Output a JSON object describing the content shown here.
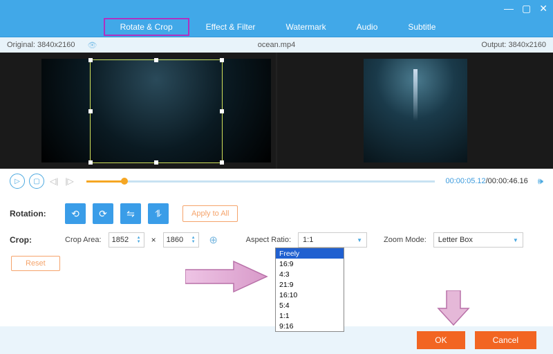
{
  "window": {
    "minimize_glyph": "—",
    "maximize_glyph": "▢",
    "close_glyph": "✕"
  },
  "tabs": {
    "rotate_crop": "Rotate & Crop",
    "effect_filter": "Effect & Filter",
    "watermark": "Watermark",
    "audio": "Audio",
    "subtitle": "Subtitle"
  },
  "infobar": {
    "original_label": "Original:",
    "original_res": "3840x2160",
    "filename": "ocean.mp4",
    "output_label": "Output:",
    "output_res": "3840x2160"
  },
  "playbar": {
    "current": "00:00:05.12",
    "total": "/00:00:46.16"
  },
  "rotation": {
    "label": "Rotation:",
    "apply_all": "Apply to All"
  },
  "crop": {
    "label": "Crop:",
    "area_label": "Crop Area:",
    "width": "1852",
    "times": "×",
    "height": "1860",
    "aspect_label": "Aspect Ratio:",
    "aspect_value": "1:1",
    "zoom_label": "Zoom Mode:",
    "zoom_value": "Letter Box",
    "reset": "Reset"
  },
  "aspect_options": [
    "Freely",
    "16:9",
    "4:3",
    "21:9",
    "16:10",
    "5:4",
    "1:1",
    "9:16"
  ],
  "aspect_selected_index": 0,
  "footer": {
    "ok": "OK",
    "cancel": "Cancel"
  }
}
